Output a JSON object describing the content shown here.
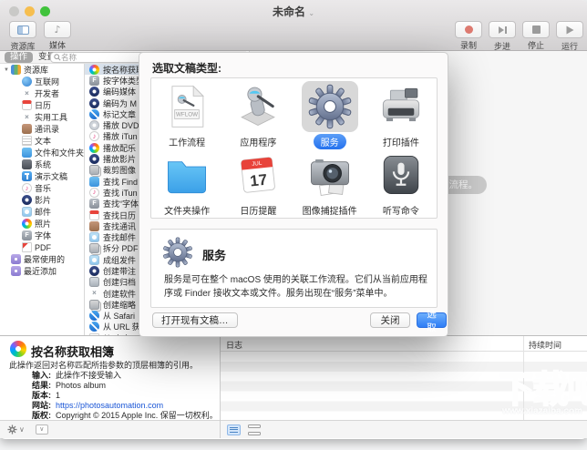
{
  "window": {
    "title": "未命名",
    "title_chevron": "⌄"
  },
  "toolbar": {
    "left": [
      {
        "label": "资源库",
        "icon": "library-sidebar"
      },
      {
        "label": "媒体",
        "icon": "media-note"
      }
    ],
    "right": [
      {
        "label": "录制",
        "icon": "record"
      },
      {
        "label": "步进",
        "icon": "step"
      },
      {
        "label": "停止",
        "icon": "stop"
      },
      {
        "label": "运行",
        "icon": "run"
      }
    ]
  },
  "filterbar": {
    "tabs": [
      {
        "label": "操作",
        "selected": true
      },
      {
        "label": "变量",
        "selected": false
      }
    ],
    "search_placeholder": "名称"
  },
  "sidebar": {
    "tree": [
      {
        "label": "资源库",
        "icon": "library",
        "level": 0,
        "disclosure": true
      },
      {
        "label": "互联网",
        "icon": "globe",
        "level": 1
      },
      {
        "label": "开发者",
        "icon": "xtools",
        "level": 1
      },
      {
        "label": "日历",
        "icon": "cal",
        "level": 1
      },
      {
        "label": "实用工具",
        "icon": "xtools",
        "level": 1
      },
      {
        "label": "通讯录",
        "icon": "contacts",
        "level": 1
      },
      {
        "label": "文本",
        "icon": "text",
        "level": 1
      },
      {
        "label": "文件和文件夹",
        "icon": "finder",
        "level": 1
      },
      {
        "label": "系统",
        "icon": "system",
        "level": 1
      },
      {
        "label": "演示文稿",
        "icon": "keynote",
        "level": 1
      },
      {
        "label": "音乐",
        "icon": "itunes",
        "level": 1
      },
      {
        "label": "影片",
        "icon": "qt",
        "level": 1
      },
      {
        "label": "邮件",
        "icon": "mail",
        "level": 1
      },
      {
        "label": "照片",
        "icon": "photos",
        "level": 1
      },
      {
        "label": "字体",
        "icon": "fontbook",
        "level": 1
      },
      {
        "label": "PDF",
        "icon": "pdf",
        "level": 1
      },
      {
        "label": "最常使用的",
        "icon": "smart",
        "level": 0,
        "smart": true
      },
      {
        "label": "最近添加",
        "icon": "smart",
        "level": 0,
        "smart": true
      }
    ]
  },
  "actions": {
    "items": [
      {
        "label": "按名称获取相簿",
        "icon": "photos",
        "selected": true
      },
      {
        "label": "按字体类型",
        "icon": "fontbook"
      },
      {
        "label": "编码媒体",
        "icon": "qt"
      },
      {
        "label": "编码为 M",
        "icon": "qt"
      },
      {
        "label": "标记文章",
        "icon": "safari"
      },
      {
        "label": "播放 DVD",
        "icon": "dvd"
      },
      {
        "label": "播放 iTun",
        "icon": "itunes"
      },
      {
        "label": "播放配乐",
        "icon": "photos"
      },
      {
        "label": "播放影片",
        "icon": "qt"
      },
      {
        "label": "裁剪图像",
        "icon": "images"
      },
      {
        "label": "查找 Find",
        "icon": "finder"
      },
      {
        "label": "查找 iTun",
        "icon": "itunes"
      },
      {
        "label": "查找“字体",
        "icon": "fontbook"
      },
      {
        "label": "查找日历",
        "icon": "cal"
      },
      {
        "label": "查找通讯",
        "icon": "contacts"
      },
      {
        "label": "查找邮件",
        "icon": "mail"
      },
      {
        "label": "拆分 PDF",
        "icon": "images"
      },
      {
        "label": "成组发件",
        "icon": "mail"
      },
      {
        "label": "创建带注",
        "icon": "qt"
      },
      {
        "label": "创建归档",
        "icon": "archive"
      },
      {
        "label": "创建软件",
        "icon": "xtools"
      },
      {
        "label": "创建缩略",
        "icon": "images"
      },
      {
        "label": "从 Safari",
        "icon": "safari"
      },
      {
        "label": "从 URL 获",
        "icon": "safari"
      },
      {
        "label": "从“文本",
        "icon": "text"
      }
    ]
  },
  "canvas": {
    "hint": "作流程。"
  },
  "dialog": {
    "title": "选取文稿类型:",
    "types": [
      {
        "label": "工作流程",
        "icon": "workflow",
        "badge": "WFLOW"
      },
      {
        "label": "应用程序",
        "icon": "application"
      },
      {
        "label": "服务",
        "icon": "service",
        "selected": true
      },
      {
        "label": "打印插件",
        "icon": "printer"
      },
      {
        "label": "文件夹操作",
        "icon": "folder"
      },
      {
        "label": "日历提醒",
        "icon": "calendar",
        "cal_month": "JUL",
        "cal_day": "17"
      },
      {
        "label": "图像捕捉插件",
        "icon": "camera"
      },
      {
        "label": "听写命令",
        "icon": "microphone"
      }
    ],
    "detail": {
      "title": "服务",
      "description": "服务是可在整个 macOS 使用的关联工作流程。它们从当前应用程序或 Finder 接收文本或文件。服务出现在“服务”菜单中。"
    },
    "buttons": {
      "open": "打开现有文稿…",
      "close": "关闭",
      "choose": "选取"
    }
  },
  "info_panel": {
    "title": "按名称获取相簿",
    "summary": "此操作返回对名称匹配所指参数的顶层相簿的引用。",
    "fields": [
      {
        "label": "输入:",
        "value": "此操作不接受输入"
      },
      {
        "label": "结果:",
        "value": "Photos album"
      },
      {
        "label": "版本:",
        "value": "1"
      },
      {
        "label": "网站:",
        "value": "https://photosautomation.com",
        "link": true
      },
      {
        "label": "版权:",
        "value": "Copyright © 2015 Apple Inc. 保留一切权利。"
      }
    ]
  },
  "log_panel": {
    "log_header": "日志",
    "duration_header": "持续时间"
  },
  "watermark": {
    "title": "下载吧",
    "url": "www.xiazaiba.com"
  },
  "colors": {
    "accent": "#2e7df6",
    "record_red": "#dd7a70",
    "selection": "#d9e2ec",
    "link": "#1a56d6"
  }
}
